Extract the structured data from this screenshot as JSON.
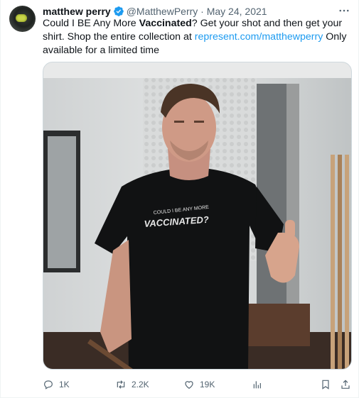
{
  "tweet": {
    "author_name": "matthew perry",
    "handle_date": "@MatthewPerry · May 24, 2021",
    "text_part1": "Could I BE Any More ",
    "text_bold": "Vaccinated",
    "text_part2": "? Get your shot and then get your shirt. Shop the entire collection at ",
    "link_text": "represent.com/matthewperry",
    "text_part3": " Only available for a limited time",
    "media_description": "Man in black t-shirt giving a thumbs up",
    "shirt_text_line1": "COULD I BE ANY MORE",
    "shirt_text_line2": "VACCINATED?"
  },
  "actions": {
    "reply_count": "1K",
    "retweet_count": "2.2K",
    "like_count": "19K"
  },
  "icons": {
    "verified": "verified-badge-icon",
    "more": "more-options-icon",
    "reply": "reply-icon",
    "retweet": "retweet-icon",
    "like": "like-icon",
    "views": "views-icon",
    "bookmark": "bookmark-icon",
    "share": "share-icon"
  },
  "colors": {
    "link": "#1d9bf0",
    "secondary_text": "#536471",
    "verified": "#1d9bf0"
  }
}
